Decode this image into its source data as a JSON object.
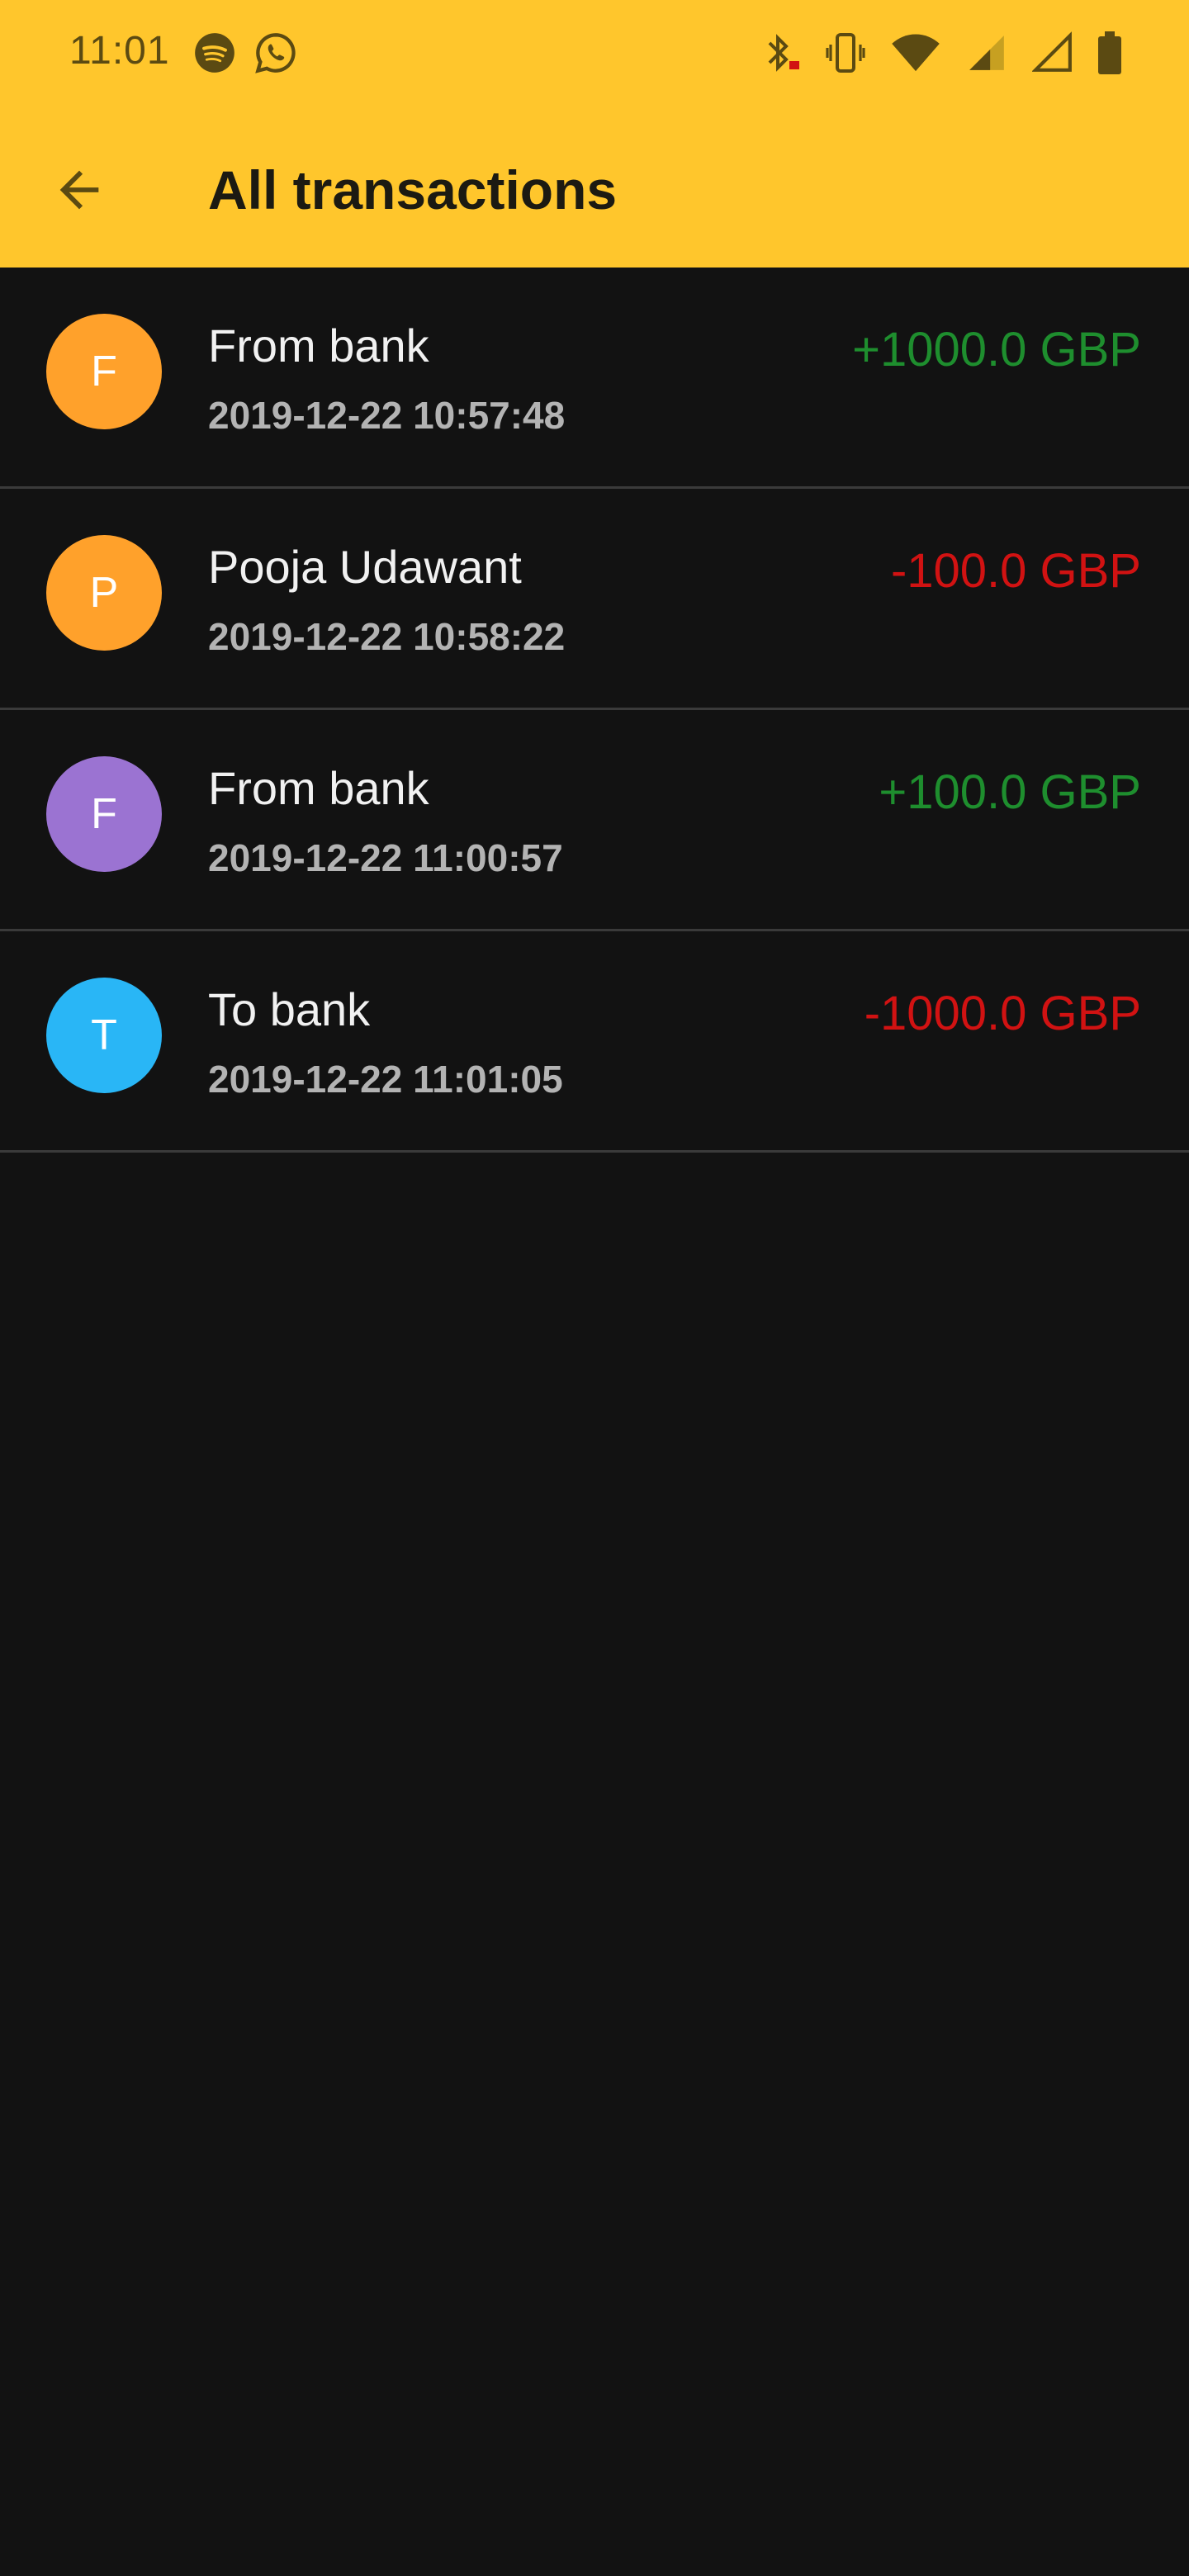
{
  "status_bar": {
    "time": "11:01",
    "left_icons": [
      "spotify-icon",
      "whatsapp-icon"
    ],
    "right_icons": [
      "bluetooth-battery-icon",
      "vibrate-icon",
      "wifi-icon",
      "cell-signal-icon",
      "cell-signal-empty-icon",
      "battery-icon"
    ]
  },
  "appbar": {
    "title": "All transactions",
    "back_icon": "arrow-back-icon",
    "background": "#ffc62c"
  },
  "colors": {
    "positive": "#1e8e2e",
    "negative": "#d11212"
  },
  "transactions": [
    {
      "initial": "F",
      "name": "From bank",
      "date": "2019-12-22 10:57:48",
      "amount": "+1000.0 GBP",
      "type": "positive",
      "avatar_color": "#ffa12b"
    },
    {
      "initial": "P",
      "name": "Pooja Udawant",
      "date": "2019-12-22 10:58:22",
      "amount": "-100.0 GBP",
      "type": "negative",
      "avatar_color": "#ffa12b"
    },
    {
      "initial": "F",
      "name": "From bank",
      "date": "2019-12-22 11:00:57",
      "amount": "+100.0 GBP",
      "type": "positive",
      "avatar_color": "#9b73d2"
    },
    {
      "initial": "T",
      "name": "To bank",
      "date": "2019-12-22 11:01:05",
      "amount": "-1000.0 GBP",
      "type": "negative",
      "avatar_color": "#29b6f6"
    }
  ]
}
